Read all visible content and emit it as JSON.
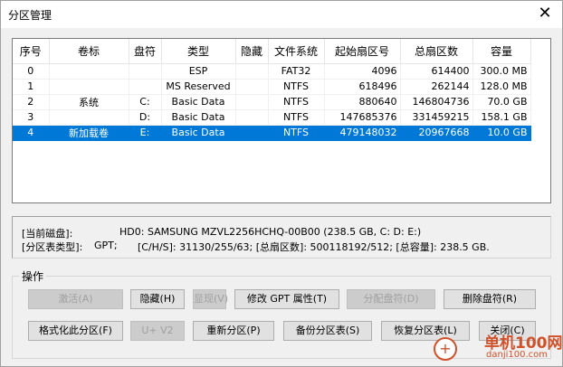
{
  "window": {
    "title": "分区管理",
    "close_glyph": "✕"
  },
  "table": {
    "columns": [
      "序号",
      "卷标",
      "盘符",
      "类型",
      "隐藏",
      "文件系统",
      "起始扇区号",
      "总扇区数",
      "容量"
    ],
    "rows": [
      [
        "0",
        "",
        "",
        "ESP",
        "",
        "FAT32",
        "4096",
        "614400",
        "300.0 MB"
      ],
      [
        "1",
        "",
        "",
        "MS Reserved",
        "",
        "NTFS",
        "618496",
        "262144",
        "128.0 MB"
      ],
      [
        "2",
        "系统",
        "C:",
        "Basic Data",
        "",
        "NTFS",
        "880640",
        "146804736",
        "70.0 GB"
      ],
      [
        "3",
        "",
        "D:",
        "Basic Data",
        "",
        "NTFS",
        "147685376",
        "331459215",
        "158.1 GB"
      ],
      [
        "4",
        "新加载卷",
        "E:",
        "Basic Data",
        "",
        "NTFS",
        "479148032",
        "20967668",
        "10.0 GB"
      ]
    ],
    "selected_row": 4
  },
  "info": {
    "line1_label": "[当前磁盘]:",
    "line1_value": "HD0: SAMSUNG MZVL2256HCHQ-00B00 (238.5 GB, C: D: E:)",
    "line2_label": "[分区表类型]:",
    "line2_value": "GPT;",
    "line2_chs": "[C/H/S]: 31130/255/63; [总扇区数]: 500118192/512; [总容量]: 238.5 GB."
  },
  "actions": {
    "group_label": "操作",
    "activate": "激活(A)",
    "hide": "隐藏(H)",
    "show": "显现(V)",
    "modify_gpt": "修改 GPT 属性(T)",
    "assign_letter": "分配盘符(D)",
    "delete_letter": "删除盘符(R)",
    "format": "格式化此分区(F)",
    "uv2": "U+ V2",
    "repartition": "重新分区(P)",
    "backup": "备份分区表(S)",
    "restore": "恢复分区表(L)",
    "close": "关闭(C)"
  },
  "watermark": {
    "line1": "单机100网",
    "line2": "danji100.com",
    "glyph": "+"
  }
}
